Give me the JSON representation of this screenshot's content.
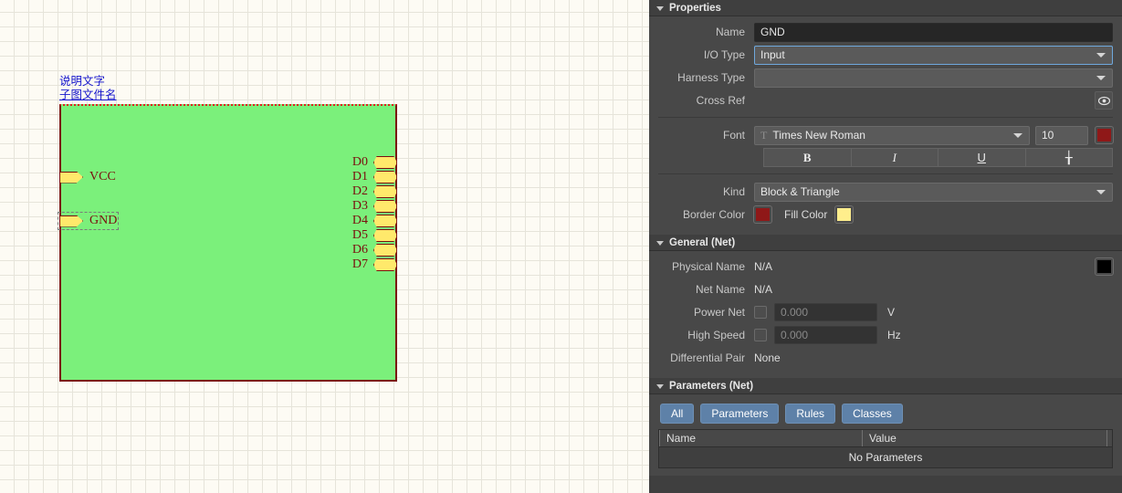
{
  "canvas": {
    "caption_description": "说明文字",
    "caption_filename": "子图文件名",
    "block_fill_color": "#7bf07b",
    "block_border_color": "#7a0f0f",
    "left_pins": [
      {
        "label": "VCC",
        "selected": false
      },
      {
        "label": "GND",
        "selected": true
      }
    ],
    "right_pins": [
      {
        "label": "D0"
      },
      {
        "label": "D1"
      },
      {
        "label": "D2"
      },
      {
        "label": "D3"
      },
      {
        "label": "D4"
      },
      {
        "label": "D5"
      },
      {
        "label": "D6"
      },
      {
        "label": "D7"
      }
    ]
  },
  "panel": {
    "properties": {
      "header": "Properties",
      "name_label": "Name",
      "name_value": "GND",
      "io_type_label": "I/O Type",
      "io_type_value": "Input",
      "harness_type_label": "Harness Type",
      "harness_type_value": "",
      "cross_ref_label": "Cross Ref",
      "cross_ref_icon": "eye-icon",
      "font_label": "Font",
      "font_family_value": "Times New Roman",
      "font_size_value": "10",
      "font_color": "#8f1818",
      "bold_label": "B",
      "italic_label": "I",
      "underline_label": "U",
      "strikethrough_label": "╁",
      "kind_label": "Kind",
      "kind_value": "Block & Triangle",
      "border_color_label": "Border Color",
      "border_color": "#8f1818",
      "fill_color_label": "Fill Color",
      "fill_color": "#ffee8c"
    },
    "general_net": {
      "header": "General (Net)",
      "physical_name_label": "Physical Name",
      "physical_name_value": "N/A",
      "net_name_label": "Net Name",
      "net_name_value": "N/A",
      "power_net_label": "Power Net",
      "power_net_value": "0.000",
      "power_net_unit": "V",
      "high_speed_label": "High Speed",
      "high_speed_value": "0.000",
      "high_speed_unit": "Hz",
      "differential_pair_label": "Differential Pair",
      "differential_pair_value": "None",
      "net_color": "#000000"
    },
    "parameters_net": {
      "header": "Parameters (Net)",
      "tabs": [
        {
          "label": "All"
        },
        {
          "label": "Parameters"
        },
        {
          "label": "Rules"
        },
        {
          "label": "Classes"
        }
      ],
      "columns": {
        "name": "Name",
        "value": "Value"
      },
      "empty_text": "No Parameters"
    }
  }
}
